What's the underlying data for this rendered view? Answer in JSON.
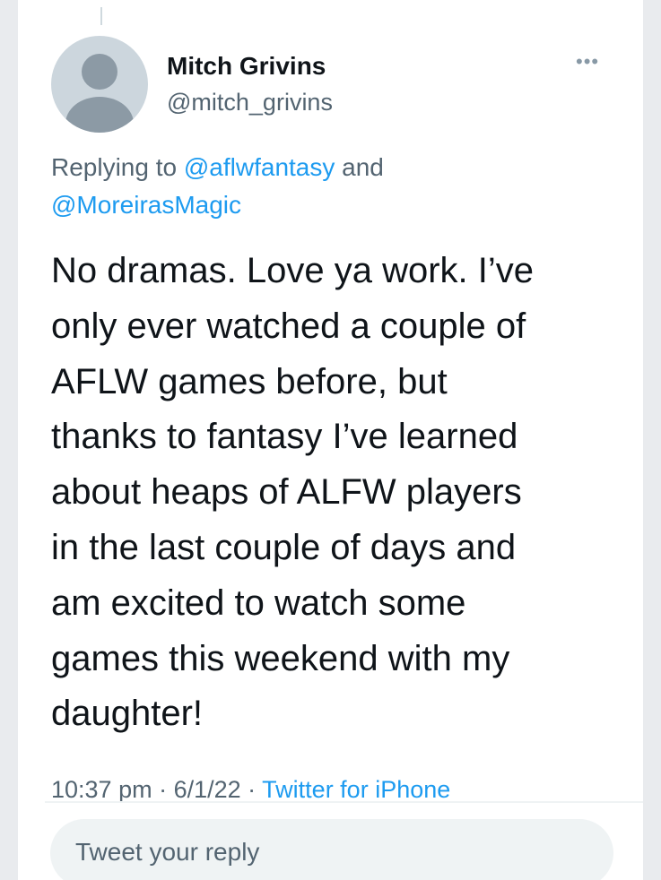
{
  "tweet": {
    "author": {
      "name": "Mitch Grivins",
      "handle": "@mitch_grivins"
    },
    "more_icon": "more-horizontal-icon",
    "replying": {
      "prefix": "Replying to ",
      "mention_1": "@aflwfantasy",
      "conjunction": " and",
      "mention_2": "@MoreirasMagic"
    },
    "text_lines": [
      "No dramas. Love ya work. I’ve",
      "only ever watched a couple of",
      "AFLW games before, but",
      "thanks to fantasy I’ve learned",
      "about heaps of ALFW players",
      "in the last couple of days and",
      "am excited to watch some",
      "games this weekend with my",
      "daughter!"
    ],
    "time": "10:37 pm",
    "separator": " · ",
    "date": "6/1/22",
    "source": "Twitter for iPhone"
  },
  "reply": {
    "placeholder": "Tweet your reply"
  },
  "colors": {
    "accent": "#1d9bf0",
    "text": "#0f1419",
    "secondary": "#536471"
  }
}
